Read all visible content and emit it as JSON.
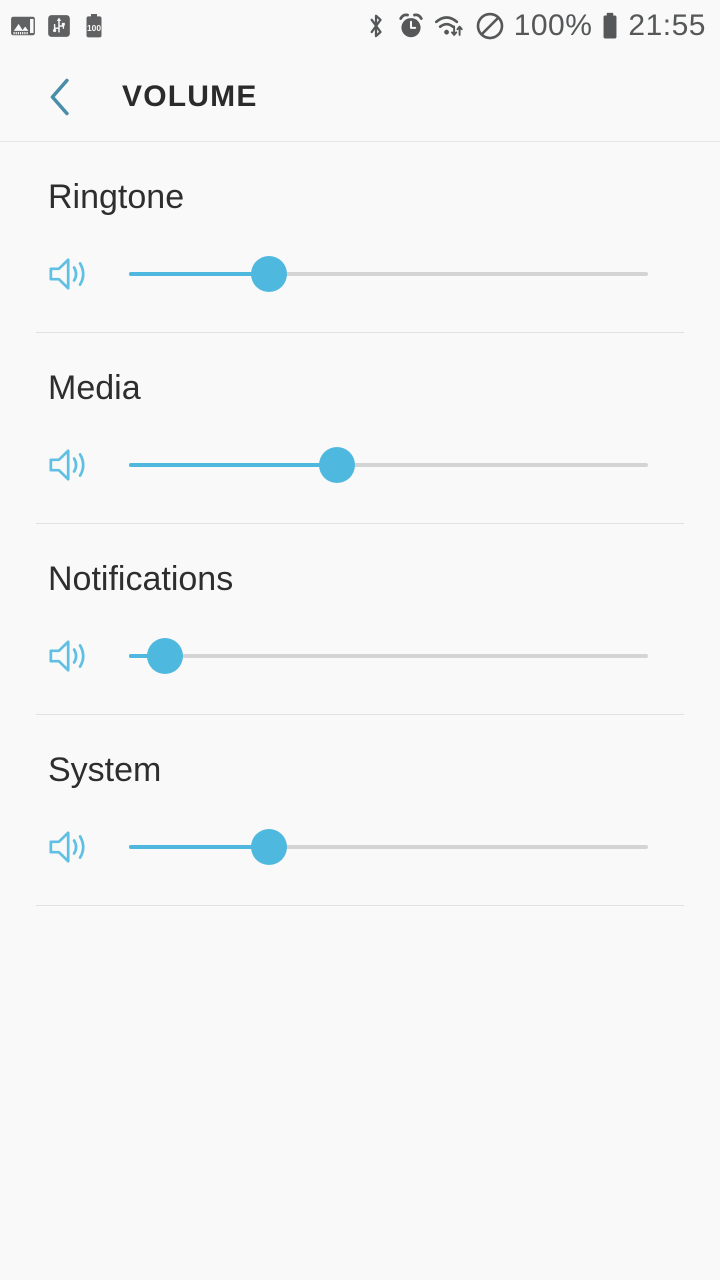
{
  "status_bar": {
    "left_icons": [
      {
        "name": "gallery-icon",
        "label": "Gallery"
      },
      {
        "name": "usb-icon",
        "label": "USB"
      },
      {
        "name": "battery-100-icon",
        "label": "100"
      }
    ],
    "right_icons": [
      {
        "name": "bluetooth-icon",
        "label": "Bluetooth"
      },
      {
        "name": "alarm-icon",
        "label": "Alarm"
      },
      {
        "name": "wifi-transfer-icon",
        "label": "Wi-Fi"
      },
      {
        "name": "do-not-disturb-icon",
        "label": "Do not disturb"
      }
    ],
    "battery_percent": "100%",
    "clock": "21:55"
  },
  "header": {
    "back_label": "Back",
    "title": "VOLUME"
  },
  "colors": {
    "accent": "#4fb8df",
    "back_chevron": "#4a8da8",
    "track": "#d4d4d4",
    "divider": "#e2e2e2",
    "background": "#f9f9f9",
    "label_text": "#2e2e2e",
    "title_text": "#2b2b2b",
    "status_text": "#555758"
  },
  "volume_rows": [
    {
      "id": "ringtone",
      "label": "Ringtone",
      "icon": "speaker-icon",
      "value_percent": 27
    },
    {
      "id": "media",
      "label": "Media",
      "icon": "speaker-icon",
      "value_percent": 40
    },
    {
      "id": "notifications",
      "label": "Notifications",
      "icon": "speaker-icon",
      "value_percent": 7
    },
    {
      "id": "system",
      "label": "System",
      "icon": "speaker-icon",
      "value_percent": 27
    }
  ]
}
